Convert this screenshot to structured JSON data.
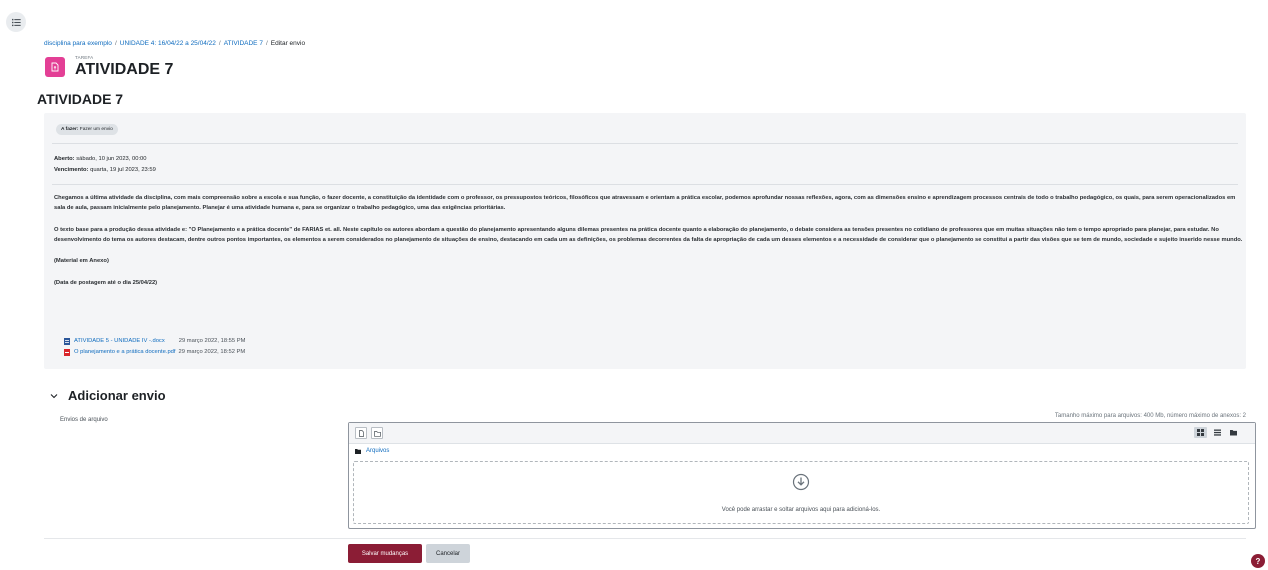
{
  "breadcrumb": {
    "items": [
      "disciplina para exemplo",
      "UNIDADE 4: 16/04/22 a 25/04/22",
      "ATIVIDADE 7"
    ],
    "separator": "/",
    "current": "Editar envio"
  },
  "header": {
    "module_type": "TAREFA",
    "title": "ATIVIDADE 7",
    "icon": "assignment-icon",
    "icon_color": "#e33f95"
  },
  "activity": {
    "heading": "ATIVIDADE 7",
    "todo_label": "A fazer:",
    "todo_value": "Fazer um envio",
    "opened_label": "Aberto:",
    "opened_value": "sábado, 10 jun 2023, 00:00",
    "due_label": "Vencimento:",
    "due_value": "quarta, 19 jul 2023, 23:59",
    "paragraphs": [
      "Chegamos a última atividade da disciplina, com mais compreensão sobre a escola e sua função, o fazer docente, a constituição da identidade com o professor, os pressupostos teóricos, filosóficos que atravessam e orientam a prática escolar, podemos aprofundar nossas reflexões, agora, com as dimensões ensino e aprendizagem processos centrais de todo o trabalho pedagógico, os quais, para serem operacionalizados em sala de aula, passam inicialmente pelo planejamento. Planejar é uma atividade humana e, para se organizar o trabalho pedagógico, uma das exigências prioritárias.",
      "O texto base para a produção dessa atividade e: \"O Planejamento e a prática docente\" de FARIAS et. all. Neste capítulo os autores abordam a questão do planejamento apresentando alguns dilemas presentes na prática docente quanto a elaboração do planejamento, o debate considera as tensões presentes no cotidiano de professores que em muitas situações não tem o tempo apropriado para planejar, para estudar. No desenvolvimento do tema os autores destacam, dentre outros pontos importantes, os elementos a serem considerados no planejamento de situações de ensino, destacando em cada um as definições, os problemas decorrentes da falta de apropriação de cada um desses elementos e a necessidade de considerar que o planejamento se constitui a partir das visões que se tem de mundo, sociedade e sujeito inserido nesse mundo.",
      "(Material em Anexo)",
      "(Data de postagem até o dia 25/04/22)"
    ],
    "attachments": [
      {
        "name": "ATIVIDADE 5 - UNIDADE IV -.docx",
        "date": "29 março 2022, 18:55 PM",
        "icon": "word-doc-icon",
        "color": "#2b579a"
      },
      {
        "name": "O planejamento e a prática docente.pdf",
        "date": "29 março 2022, 18:52 PM",
        "icon": "pdf-icon",
        "color": "#d9262b"
      }
    ]
  },
  "submission": {
    "section_title": "Adicionar envio",
    "field_label": "Envios de arquivo",
    "max_size_text": "Tamanho máximo para arquivos: 400 Mb, número máximo de anexos: 2",
    "path_folder": "Arquivos",
    "drop_text": "Você pode arrastar e soltar arquivos aqui para adicioná-los."
  },
  "buttons": {
    "save": "Salvar mudanças",
    "cancel": "Cancelar",
    "help": "?"
  },
  "colors": {
    "link": "#0f6cbf",
    "primary": "#8b1d35",
    "box_bg": "#f4f5f7"
  }
}
